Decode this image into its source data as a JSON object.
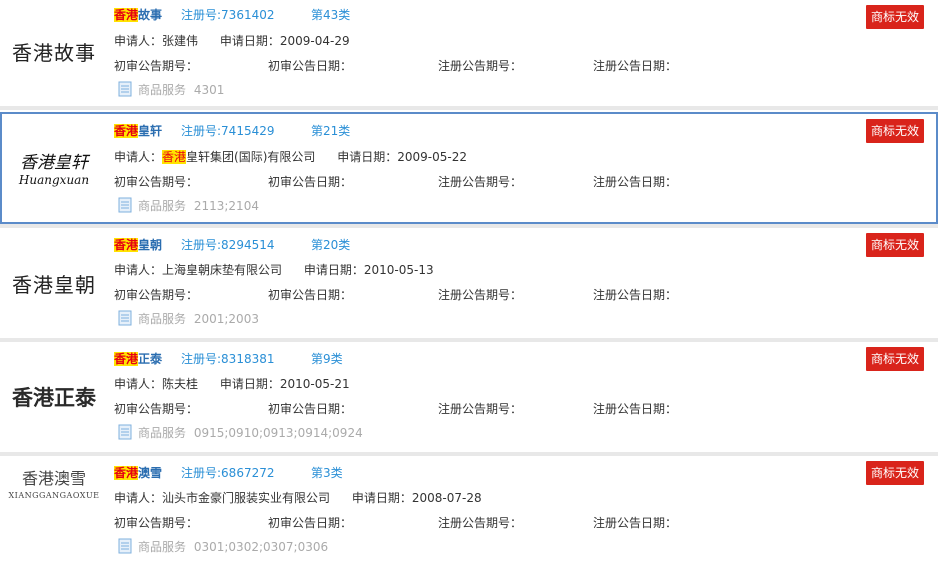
{
  "labels": {
    "applicant": "申请人：",
    "apply_date": "申请日期：",
    "prelim_no": "初审公告期号：",
    "prelim_date": "初审公告日期：",
    "reg_no": "注册公告期号：",
    "reg_date": "注册公告日期：",
    "services": "商品服务"
  },
  "badge_text": "商标无效",
  "colors": {
    "badge": "#d9241b",
    "highlight": "#ffe400",
    "link": "#2a8fd6"
  },
  "records": [
    {
      "logo": "香港故事",
      "name_hl": "香港",
      "name_rest": "故事",
      "reg": "注册号:7361402",
      "cls": "第43类",
      "applicant_hl": "",
      "applicant": "张建伟",
      "apply_date": "2009-04-29",
      "services": "4301"
    },
    {
      "logo": "香港皇轩",
      "logo_sub": "Huangxuan",
      "name_hl": "香港",
      "name_rest": "皇轩",
      "reg": "注册号:7415429",
      "cls": "第21类",
      "applicant_hl": "香港",
      "applicant": "皇轩集团(国际)有限公司",
      "apply_date": "2009-05-22",
      "services": "2113;2104"
    },
    {
      "logo": "香港皇朝",
      "name_hl": "香港",
      "name_rest": "皇朝",
      "reg": "注册号:8294514",
      "cls": "第20类",
      "applicant_hl": "",
      "applicant": "上海皇朝床垫有限公司",
      "apply_date": "2010-05-13",
      "services": "2001;2003"
    },
    {
      "logo": "香港正泰",
      "name_hl": "香港",
      "name_rest": "正泰",
      "reg": "注册号:8318381",
      "cls": "第9类",
      "applicant_hl": "",
      "applicant": "陈夫桂",
      "apply_date": "2010-05-21",
      "services": "0915;0910;0913;0914;0924"
    },
    {
      "logo": "香港澳雪",
      "logo_sub": "XIANGGANGAOXUE",
      "name_hl": "香港",
      "name_rest": "澳雪",
      "reg": "注册号:6867272",
      "cls": "第3类",
      "applicant_hl": "",
      "applicant": "汕头市金豪门服装实业有限公司",
      "apply_date": "2008-07-28",
      "services": "0301;0302;0307;0306"
    }
  ]
}
